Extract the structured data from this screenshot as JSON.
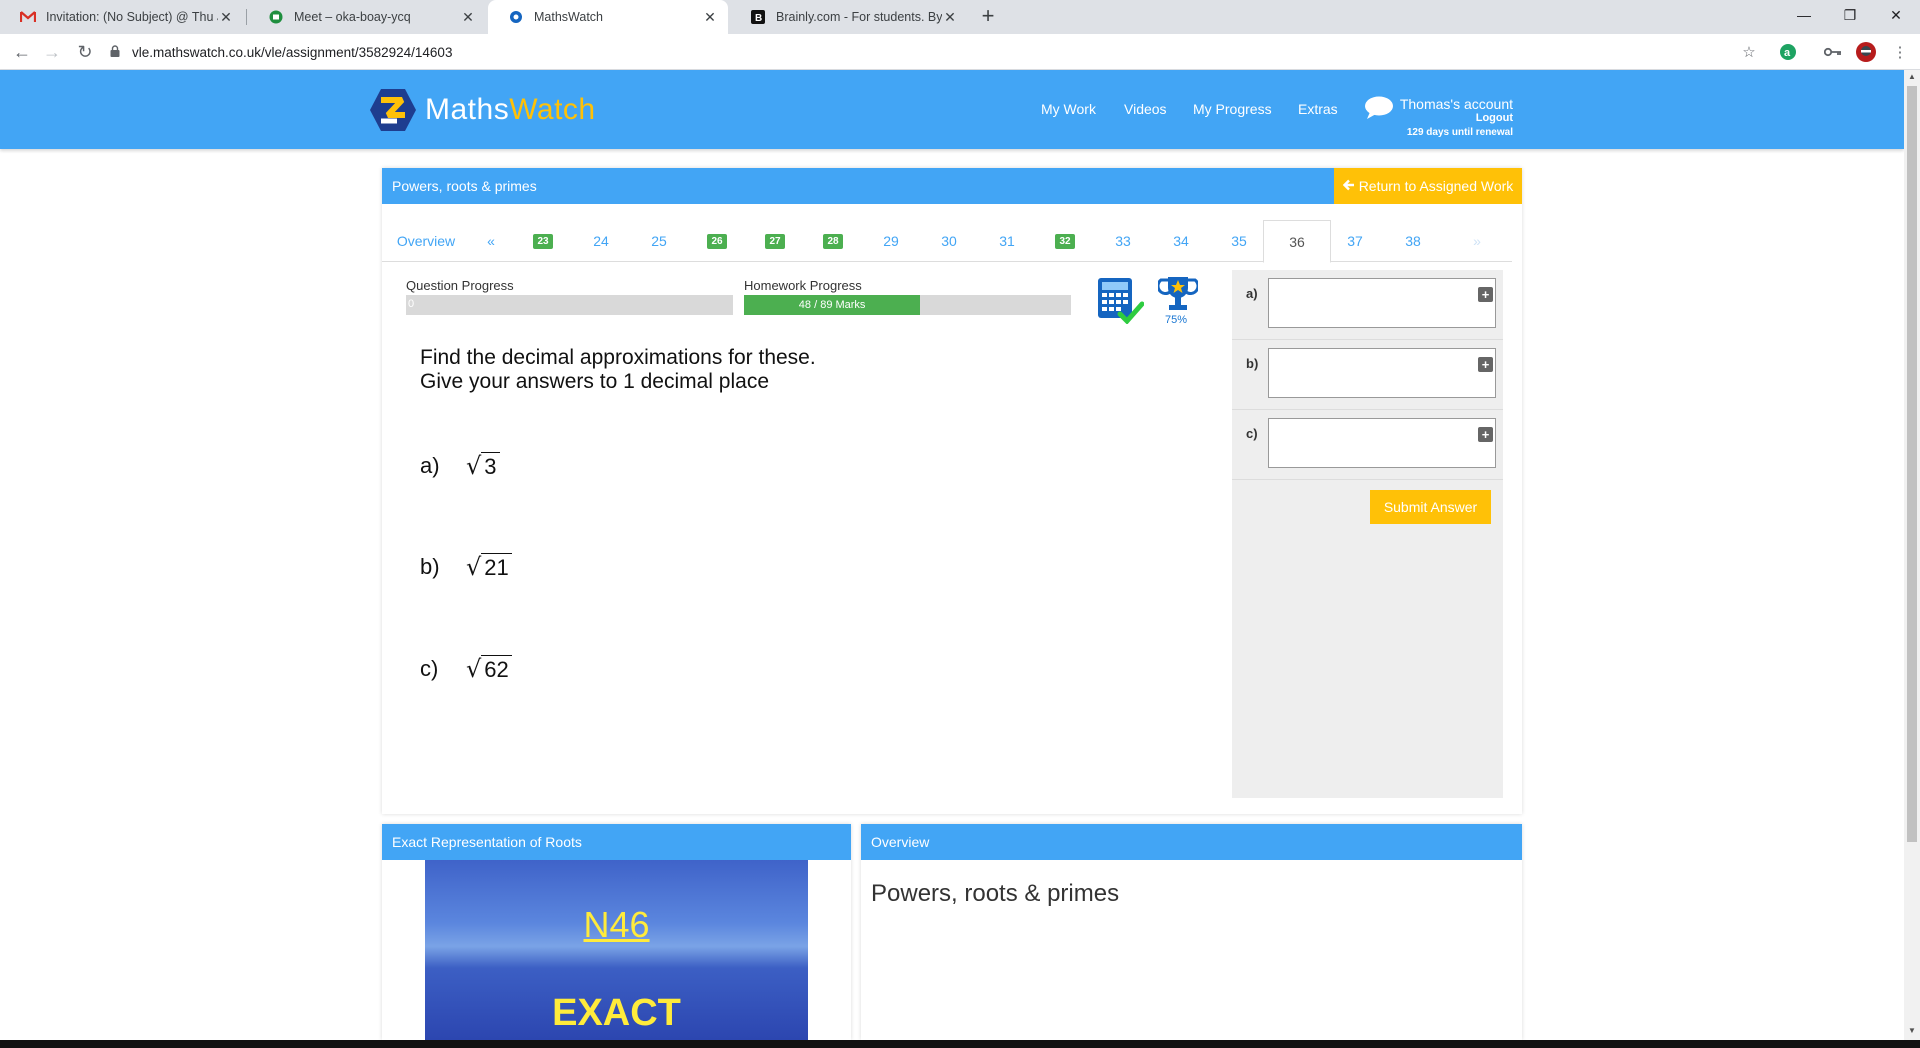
{
  "browser": {
    "tabs": [
      {
        "title": "Invitation: (No Subject) @ Thu Ju",
        "icon": "gmail-icon"
      },
      {
        "title": "Meet – oka-boay-ycq",
        "icon": "meet-icon"
      },
      {
        "title": "MathsWatch",
        "icon": "mathswatch-icon"
      },
      {
        "title": "Brainly.com - For students. By stu",
        "icon": "brainly-icon"
      }
    ],
    "url": "vle.mathswatch.co.uk/vle/assignment/3582924/14603"
  },
  "header": {
    "logo_maths": "Maths",
    "logo_watch": "Watch",
    "nav": [
      "My Work",
      "Videos",
      "My Progress",
      "Extras"
    ],
    "account_name": "Thomas's account",
    "logout": "Logout",
    "renewal": "129 days until renewal"
  },
  "panel": {
    "title": "Powers, roots & primes",
    "return_label": "Return to Assigned Work",
    "overview_tab": "Overview",
    "prev_tab": "«",
    "next_tab": "»",
    "question_tabs": [
      {
        "label": "23",
        "completed": true
      },
      {
        "label": "24",
        "completed": false
      },
      {
        "label": "25",
        "completed": false
      },
      {
        "label": "26",
        "completed": true
      },
      {
        "label": "27",
        "completed": true
      },
      {
        "label": "28",
        "completed": true
      },
      {
        "label": "29",
        "completed": false
      },
      {
        "label": "30",
        "completed": false
      },
      {
        "label": "31",
        "completed": false
      },
      {
        "label": "32",
        "completed": true
      },
      {
        "label": "33",
        "completed": false
      },
      {
        "label": "34",
        "completed": false
      },
      {
        "label": "35",
        "completed": false
      },
      {
        "label": "36",
        "completed": false,
        "active": true
      },
      {
        "label": "37",
        "completed": false
      },
      {
        "label": "38",
        "completed": false
      }
    ],
    "question_progress_label": "Question Progress",
    "question_progress_value": "0",
    "question_progress_fraction": 0,
    "homework_progress_label": "Homework Progress",
    "homework_progress_text": "48 / 89 Marks",
    "homework_progress_fraction": 0.539,
    "trophy_percent": "75%",
    "question_line1": "Find the decimal approximations for these.",
    "question_line2": "Give your answers to 1 decimal place",
    "parts": [
      {
        "label": "a)",
        "radicand": "3"
      },
      {
        "label": "b)",
        "radicand": "21"
      },
      {
        "label": "c)",
        "radicand": "62"
      }
    ],
    "answers": [
      {
        "label": "a)",
        "value": ""
      },
      {
        "label": "b)",
        "value": ""
      },
      {
        "label": "c)",
        "value": ""
      }
    ],
    "submit_label": "Submit Answer"
  },
  "video_panel": {
    "title": "Exact Representation of Roots",
    "code": "N46",
    "word": "EXACT"
  },
  "overview_panel": {
    "title": "Overview",
    "text": "Powers, roots & primes"
  },
  "colors": {
    "brand_blue": "#42a5f5",
    "accent_yellow": "#ffc107",
    "success_green": "#4caf50"
  }
}
